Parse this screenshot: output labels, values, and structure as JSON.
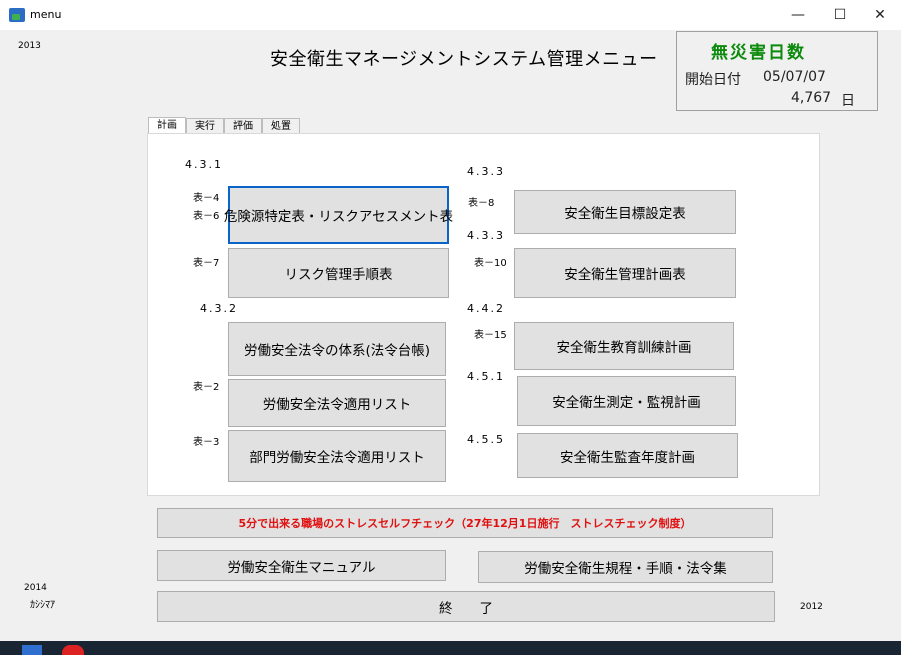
{
  "window": {
    "title": "menu",
    "minimize": "—",
    "maximize": "☐",
    "close": "✕"
  },
  "years": {
    "top_left": "2013",
    "bottom_left": "2014",
    "bottom_left_sub": "ｶｼｼﾏｱ",
    "bottom_right": "2012"
  },
  "header": {
    "title": "安全衛生マネージメントシステム管理メニュー"
  },
  "counter": {
    "title": "無災害日数",
    "start_label": "開始日付",
    "start_value": "05/07/07",
    "days_value": "4,767",
    "days_unit": "日",
    "title_color": "#0b8a0b"
  },
  "tabs": [
    {
      "label": "計画"
    },
    {
      "label": "実行"
    },
    {
      "label": "評価"
    },
    {
      "label": "処置"
    }
  ],
  "sections": {
    "s431": "4.3.1",
    "s433a": "4.3.3",
    "s433b": "4.3.3",
    "s432": "4.3.2",
    "s442": "4.4.2",
    "s451": "4.5.1",
    "s455": "4.5.5"
  },
  "table_refs": {
    "t4": "表－4",
    "t6": "表－6",
    "t7": "表－7",
    "t2": "表－2",
    "t3": "表－3",
    "t8": "表－8",
    "t10": "表－10",
    "t15": "表－15"
  },
  "buttons": {
    "hazard": "危険源特定表・リスクアセスメント表",
    "risk_procedure": "リスク管理手順表",
    "law_system": "労働安全法令の体系(法令台帳)",
    "law_list": "労働安全法令適用リスト",
    "dept_law_list": "部門労働安全法令適用リスト",
    "goal_table": "安全衛生目標設定表",
    "mgmt_plan": "安全衛生管理計画表",
    "training_plan": "安全衛生教育訓練計画",
    "measurement_plan": "安全衛生測定・監視計画",
    "audit_plan": "安全衛生監査年度計画",
    "stress_check": "5分で出来る職場のストレスセルフチェック（27年12月1日施行　ストレスチェック制度）",
    "manual": "労働安全衛生マニュアル",
    "rules": "労働安全衛生規程・手順・法令集",
    "exit": "終　　了"
  },
  "colors": {
    "accent_focus": "#0a64c8",
    "stress_text": "#e01010"
  }
}
